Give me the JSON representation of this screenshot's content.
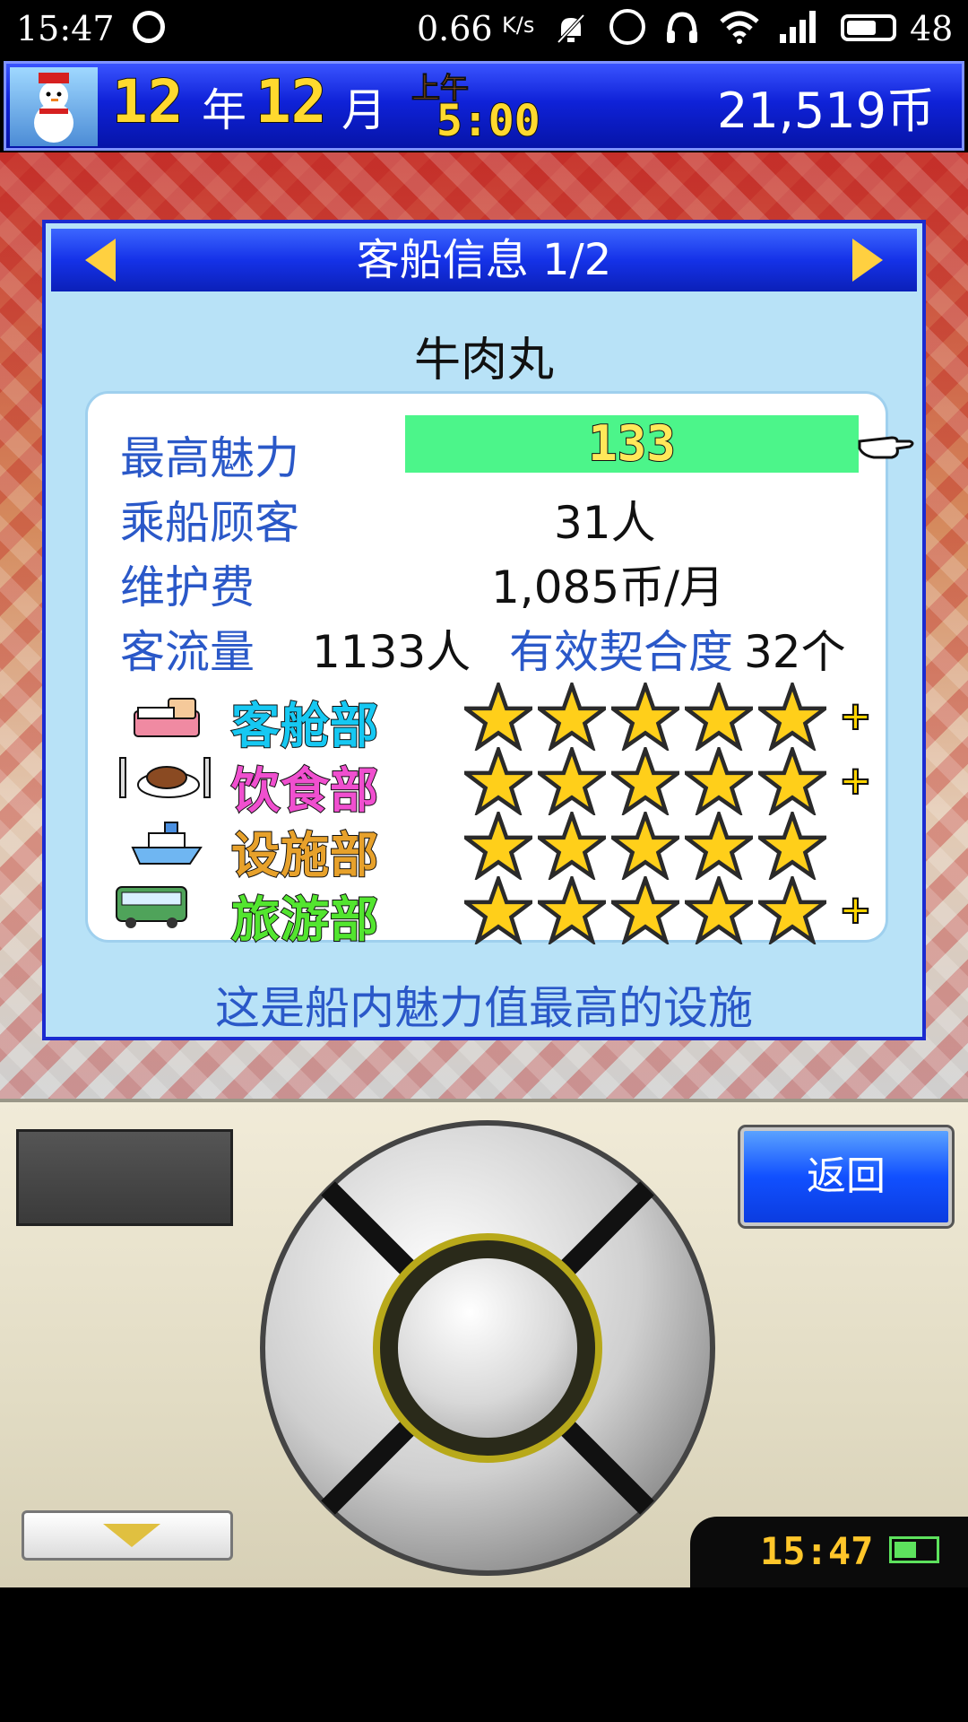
{
  "status_bar": {
    "time": "15:47",
    "net_speed": "0.66",
    "net_unit": "K/s",
    "battery": "48"
  },
  "game_bar": {
    "year_value": "12",
    "year_unit": "年",
    "month_value": "12",
    "month_unit": "月",
    "period": "上午",
    "clock": "5:00",
    "money": "21,519币"
  },
  "dialog": {
    "title": "客船信息 1/2",
    "facility_name": "牛肉丸",
    "rows": {
      "max_charm_label": "最高魅力",
      "max_charm_value": "133",
      "passengers_label": "乘船顾客",
      "passengers_value": "31人",
      "maintenance_label": "维护费",
      "maintenance_value": "1,085币/月",
      "traffic_label": "客流量",
      "traffic_value": "1133人",
      "fit_label": "有效契合度",
      "fit_value": "32个"
    },
    "departments": [
      {
        "name": "客舱部",
        "stars": 5,
        "plus": "+",
        "color": "#16c8f2"
      },
      {
        "name": "饮食部",
        "stars": 5,
        "plus": "+",
        "color": "#f04fcf"
      },
      {
        "name": "设施部",
        "stars": 5,
        "plus": "",
        "color": "#e7a12b"
      },
      {
        "name": "旅游部",
        "stars": 5,
        "plus": "+",
        "color": "#53e52f"
      }
    ],
    "footer": "这是船内魅力值最高的设施"
  },
  "controls": {
    "back_label": "返回",
    "device_clock": "15:47"
  },
  "colors": {
    "charm_bar": "#4cf58a",
    "label_blue": "#2a58c8"
  }
}
